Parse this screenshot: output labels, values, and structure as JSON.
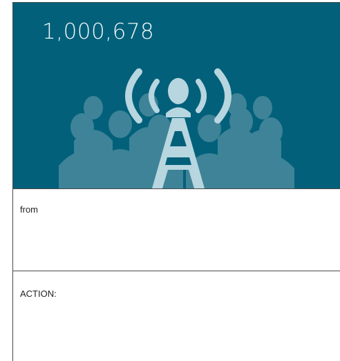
{
  "hero": {
    "count": "1,000,678",
    "background_color": "#02607a",
    "illustration_icon": "broadcast-tower-audience-icon"
  },
  "from": {
    "label": "from",
    "value": ""
  },
  "action": {
    "label": "ACTION:",
    "value": ""
  }
}
